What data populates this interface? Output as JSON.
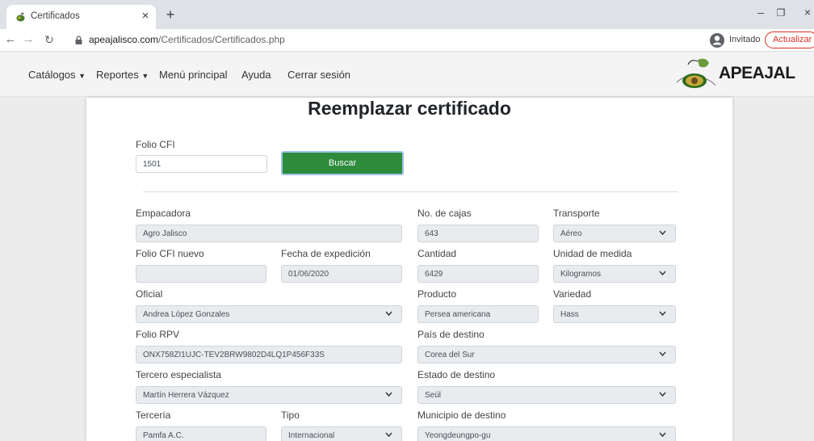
{
  "browser": {
    "tab_title": "Certificados",
    "url_domain": "apeajalisco.com",
    "url_path": "/Certificados/Certificados.php",
    "guest_label": "Invitado",
    "update_label": "Actualizar",
    "icons": [
      "favicon-icon",
      "close-icon",
      "new-tab-icon",
      "back-icon",
      "forward-icon",
      "reload-icon",
      "lock-icon",
      "profile-icon",
      "minimize-icon",
      "restore-icon"
    ]
  },
  "nav": {
    "catalogos": "Catálogos",
    "reportes": "Reportes",
    "menu_principal": "Menú principal",
    "ayuda": "Ayuda",
    "cerrar_sesion": "Cerrar sesión",
    "logo_text": "APEAJAL",
    "accent": "#2e8b3c"
  },
  "form": {
    "title": "Reemplazar certificado",
    "folio_cfi": {
      "label": "Folio CFI",
      "value": "1501"
    },
    "buscar_label": "Buscar",
    "empacadora": {
      "label": "Empacadora",
      "value": "Agro Jalisco"
    },
    "no_cajas": {
      "label": "No. de cajas",
      "value": "643"
    },
    "transporte": {
      "label": "Transporte",
      "value": "Aéreo"
    },
    "folio_cfi_nuevo": {
      "label": "Folio CFI nuevo",
      "value": ""
    },
    "fecha_expedicion": {
      "label": "Fecha de expedición",
      "value": "01/06/2020"
    },
    "cantidad": {
      "label": "Cantidad",
      "value": "6429"
    },
    "unidad_medida": {
      "label": "Unidad de medida",
      "value": "Kilogramos"
    },
    "oficial": {
      "label": "Oficial",
      "value": "Andrea López Gonzales"
    },
    "producto": {
      "label": "Producto",
      "value": "Persea americana"
    },
    "variedad": {
      "label": "Variedad",
      "value": "Hass"
    },
    "folio_rpv": {
      "label": "Folio RPV",
      "value": "ONX758ZI1UJC-TEV2BRW9802D4LQ1P456F33S"
    },
    "pais_destino": {
      "label": "País de destino",
      "value": "Corea del Sur"
    },
    "tercero_especialista": {
      "label": "Tercero especialista",
      "value": "Martín Herrera Vázquez"
    },
    "estado_destino": {
      "label": "Estado de destino",
      "value": "Seúl"
    },
    "terceria": {
      "label": "Tercería",
      "value": "Pamfa A.C."
    },
    "tipo": {
      "label": "Tipo",
      "value": "Internacional"
    },
    "municipio_destino": {
      "label": "Municipio de destino",
      "value": "Yeongdeungpo-gu"
    }
  }
}
